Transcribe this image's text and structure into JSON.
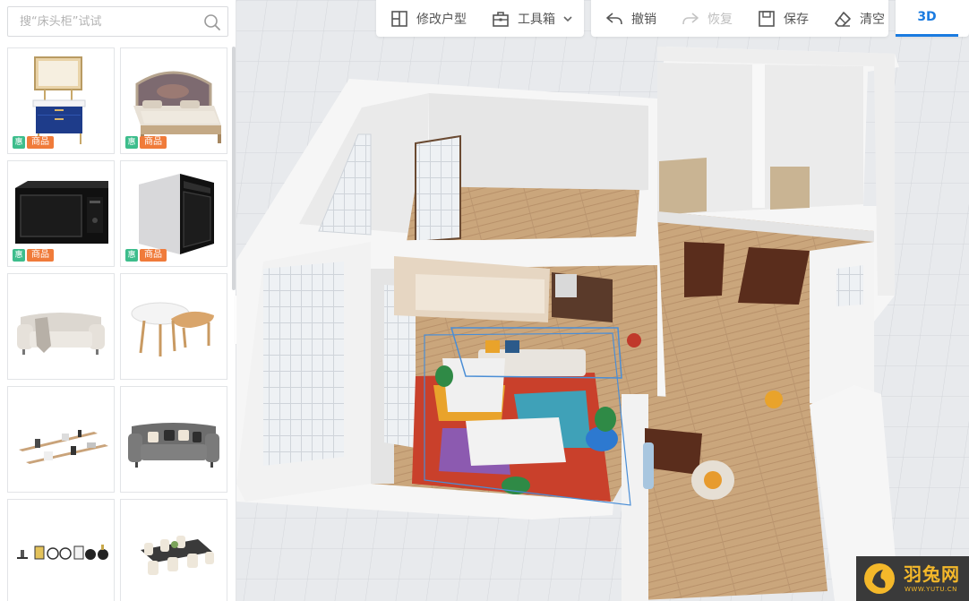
{
  "search": {
    "placeholder": "搜“床头柜”试试"
  },
  "catalog": {
    "tag_icon": "惠",
    "tag_label": "商品",
    "items": [
      {
        "name": "bathroom-vanity",
        "tagged": true
      },
      {
        "name": "double-bed",
        "tagged": true
      },
      {
        "name": "microwave-oven",
        "tagged": true
      },
      {
        "name": "built-in-oven",
        "tagged": true
      },
      {
        "name": "sofa-with-throw",
        "tagged": false
      },
      {
        "name": "coffee-tables",
        "tagged": false
      },
      {
        "name": "wall-shelves",
        "tagged": false
      },
      {
        "name": "gray-sofa",
        "tagged": false
      },
      {
        "name": "shelf-decor",
        "tagged": false
      },
      {
        "name": "dining-set",
        "tagged": false
      }
    ]
  },
  "toolbar": {
    "edit_floorplan": "修改户型",
    "toolbox": "工具箱",
    "undo": "撤销",
    "redo": "恢复",
    "save": "保存",
    "clear": "清空",
    "view_mode": "3D"
  },
  "watermark": {
    "title": "羽兔网",
    "url": "WWW.YUTU.CN"
  },
  "colors": {
    "accent": "#1a7be0",
    "tag_green": "#3dbd8c",
    "tag_orange": "#f07b3a",
    "floor_wood": "#c8a57c",
    "wall": "#f4f4f4"
  }
}
